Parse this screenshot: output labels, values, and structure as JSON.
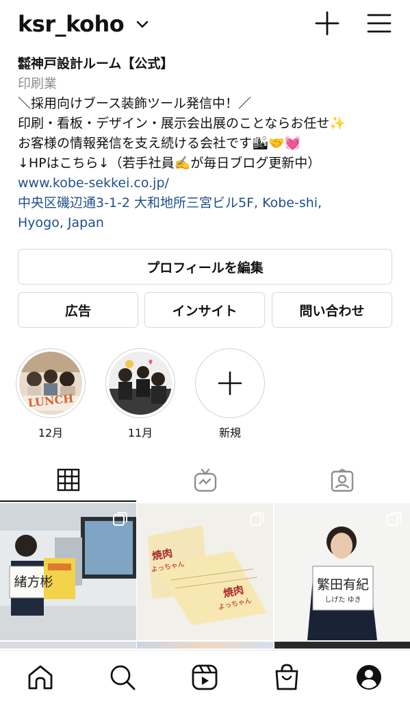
{
  "header": {
    "username": "ksr_koho"
  },
  "profile": {
    "name": "㍿神戸設計ルーム【公式】",
    "category": "印刷業",
    "bio_lines": [
      "＼採用向けブース装飾ツール発信中！／",
      "印刷・看板・デザイン・展示会出展のことならお任せ✨",
      "お客様の情報発信を支え続ける会社です🏙🤝💓",
      "↓HPはこちら↓（若手社員✍️が毎日ブログ更新中）"
    ],
    "website": "www.kobe-sekkei.co.jp/",
    "address_line1": "中央区磯辺通3-1-2 大和地所三宮ビル5F, Kobe-shi,",
    "address_line2": "Hyogo, Japan"
  },
  "buttons": {
    "edit_profile": "プロフィールを編集",
    "ads": "広告",
    "insights": "インサイト",
    "contact": "問い合わせ"
  },
  "highlights": [
    {
      "label": "12月",
      "overlay_text": "LUNCH"
    },
    {
      "label": "11月"
    },
    {
      "label": "新規"
    }
  ],
  "tabs": [
    {
      "icon": "grid-icon",
      "active": true
    },
    {
      "icon": "igtv-icon",
      "active": false
    },
    {
      "icon": "tagged-icon",
      "active": false
    }
  ],
  "posts": [
    {
      "sign_text": "緒方彬"
    },
    {
      "card_text1": "焼肉",
      "card_text2": "よっちゃん"
    },
    {
      "sign_name": "繁田有紀",
      "sign_reading": "しげた ゆき"
    }
  ],
  "bottom_nav": [
    "home-icon",
    "search-icon",
    "reels-icon",
    "shop-icon",
    "profile-icon"
  ],
  "colors": {
    "link": "#1e4f8c",
    "muted": "#8e8e8e",
    "border": "#d9d9d9"
  }
}
